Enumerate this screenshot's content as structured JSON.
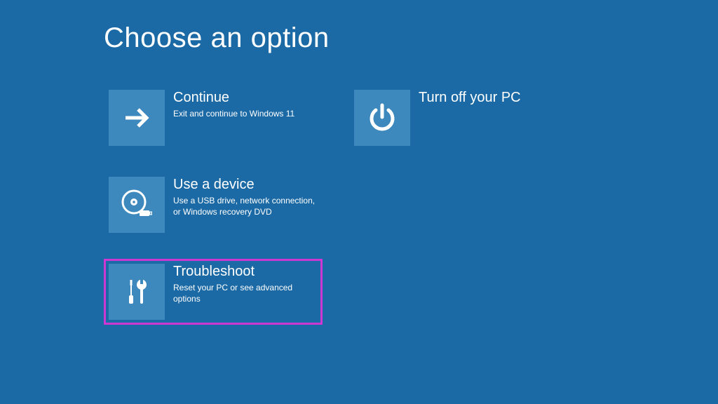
{
  "title": "Choose an option",
  "colors": {
    "background": "#1c6aa5",
    "tile_icon_bg": "#3d89bd",
    "highlight": "#cf37d2"
  },
  "tiles": {
    "continue": {
      "title": "Continue",
      "desc": "Exit and continue to Windows 11",
      "icon": "arrow-right"
    },
    "use_device": {
      "title": "Use a device",
      "desc": "Use a USB drive, network connection, or Windows recovery DVD",
      "icon": "disc-usb"
    },
    "troubleshoot": {
      "title": "Troubleshoot",
      "desc": "Reset your PC or see advanced options",
      "icon": "tools",
      "highlighted": true
    },
    "turn_off": {
      "title": "Turn off your PC",
      "desc": "",
      "icon": "power"
    }
  }
}
